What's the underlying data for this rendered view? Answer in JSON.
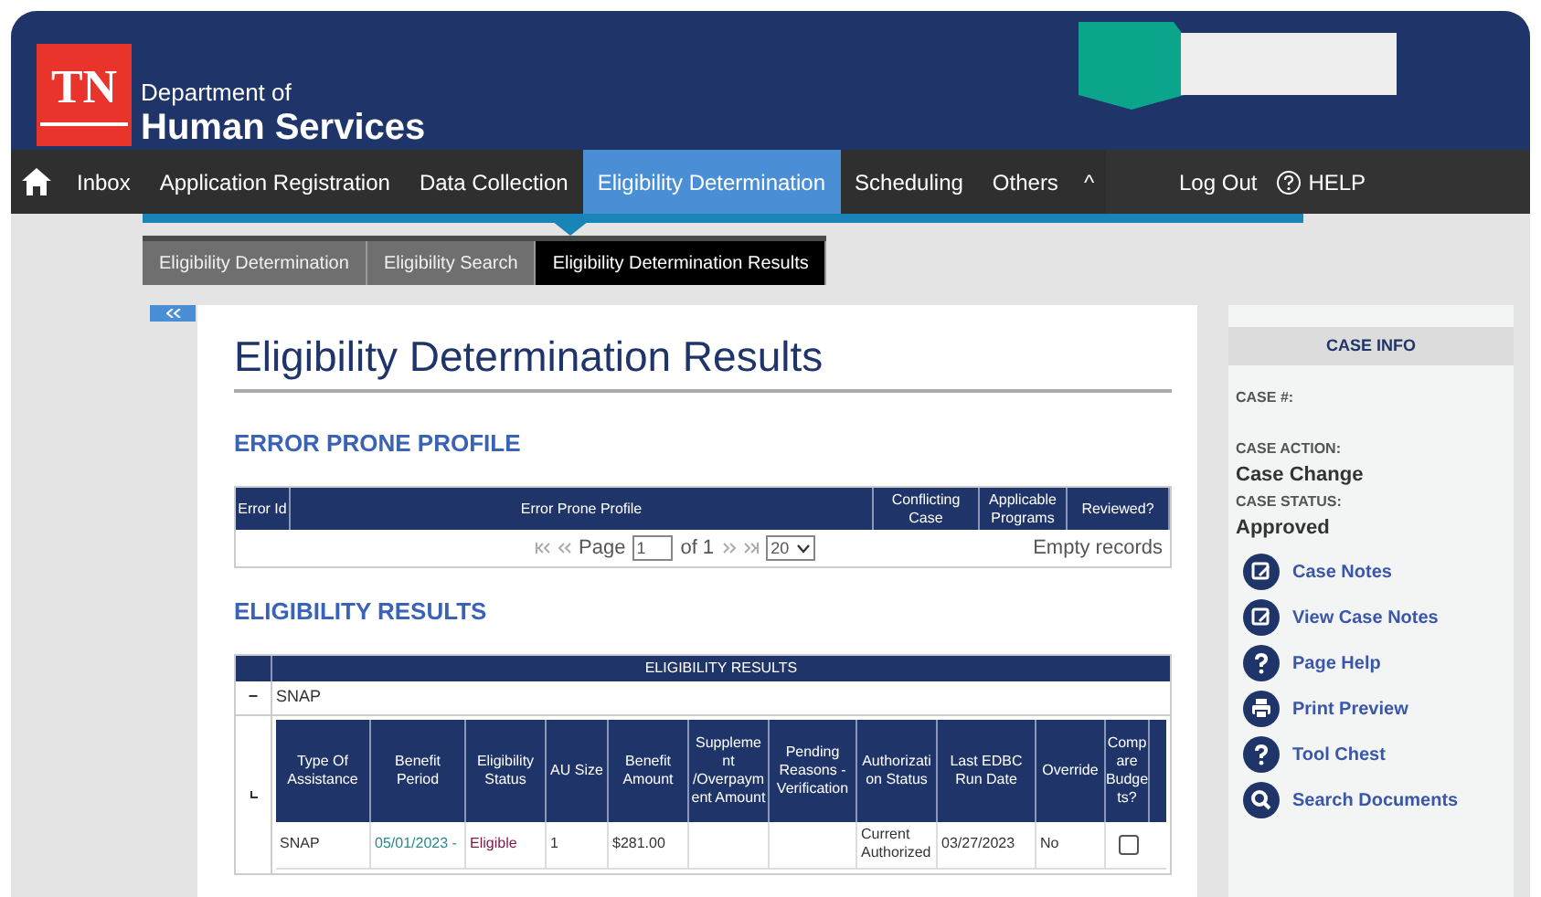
{
  "header": {
    "logo_text": "TN",
    "org_line1": "Department of",
    "org_line2": "Human Services"
  },
  "nav": {
    "items": [
      {
        "label": "Inbox",
        "selected": false
      },
      {
        "label": "Application Registration",
        "selected": false
      },
      {
        "label": "Data Collection",
        "selected": false
      },
      {
        "label": "Eligibility Determination",
        "selected": true
      },
      {
        "label": "Scheduling",
        "selected": false
      },
      {
        "label": "Others",
        "selected": false
      }
    ],
    "more_toggle": "^",
    "logout": "Log Out",
    "help": "HELP"
  },
  "subtabs": [
    {
      "label": "Eligibility Determination",
      "selected": false
    },
    {
      "label": "Eligibility Search",
      "selected": false
    },
    {
      "label": "Eligibility Determination Results",
      "selected": true
    }
  ],
  "page_title": "Eligibility Determination Results",
  "error_profile": {
    "heading": "ERROR PRONE PROFILE",
    "columns": [
      "Error Id",
      "Error Prone Profile",
      "Conflicting Case",
      "Applicable Programs",
      "Reviewed?"
    ],
    "pager": {
      "page_label": "Page",
      "page_value": "1",
      "of_label": "of 1",
      "page_size": "20"
    },
    "empty_text": "Empty records"
  },
  "eligibility": {
    "heading": "ELIGIBILITY RESULTS",
    "table_title": "ELIGIBILITY RESULTS",
    "group": {
      "toggle": "−",
      "label": "SNAP"
    },
    "columns": [
      "Type Of Assistance",
      "Benefit Period",
      "Eligibility Status",
      "AU Size",
      "Benefit Amount",
      "Suppleme nt /Overpaym ent Amount",
      "Pending Reasons - Verification",
      "Authorizati on Status",
      "Last EDBC Run Date",
      "Override",
      "Comp are Budge ts?"
    ],
    "rows": [
      {
        "cells": [
          {
            "text": "SNAP",
            "kind": "plain"
          },
          {
            "text": "05/01/2023 -",
            "kind": "link"
          },
          {
            "text": "Eligible",
            "kind": "status"
          },
          {
            "text": "1",
            "kind": "plain"
          },
          {
            "text": "$281.00",
            "kind": "plain"
          },
          {
            "text": "",
            "kind": "plain"
          },
          {
            "text": "",
            "kind": "plain"
          },
          {
            "text": "Current Authorized",
            "kind": "plain"
          },
          {
            "text": "03/27/2023",
            "kind": "plain"
          },
          {
            "text": "No",
            "kind": "plain"
          }
        ],
        "compare_checked": false
      }
    ]
  },
  "case_info": {
    "title": "CASE INFO",
    "fields": [
      {
        "label": "CASE #:"
      },
      {
        "label": "CASE ACTION:",
        "value": "Case Change"
      },
      {
        "label": "CASE STATUS:",
        "value": "Approved"
      }
    ],
    "links": [
      {
        "label": "Case Notes",
        "kind": "notes"
      },
      {
        "label": "View Case Notes",
        "kind": "notes"
      },
      {
        "label": "Page Help",
        "kind": "help"
      },
      {
        "label": "Print Preview",
        "kind": "print"
      },
      {
        "label": "Tool Chest",
        "kind": "help"
      },
      {
        "label": "Search Documents",
        "kind": "search"
      }
    ]
  }
}
